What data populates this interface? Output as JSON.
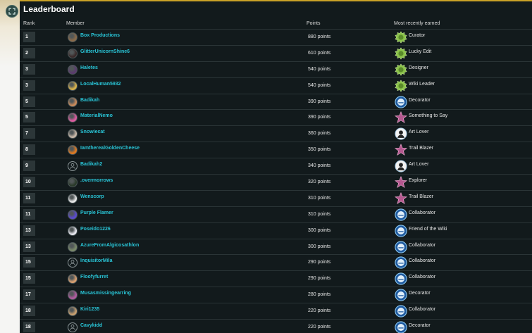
{
  "leaderboard": {
    "title": "Leaderboard",
    "columns": {
      "rank": "Rank",
      "member": "Member",
      "points": "Points",
      "badge": "Most recently earned"
    },
    "rows": [
      {
        "rank": "1",
        "member": "Box Productions",
        "points": "880 points",
        "badge": "Curator",
        "badge_icon": "green-star-badge-icon",
        "avatar": "custom"
      },
      {
        "rank": "2",
        "member": "GlitterUnicornShine6",
        "points": "610 points",
        "badge": "Lucky Edit",
        "badge_icon": "green-star-badge-icon",
        "avatar": "custom"
      },
      {
        "rank": "3",
        "member": "Haletes",
        "points": "540 points",
        "badge": "Designer",
        "badge_icon": "green-star-badge-icon",
        "avatar": "custom"
      },
      {
        "rank": "3",
        "member": "LocalHuman5932",
        "points": "540 points",
        "badge": "Wiki Leader",
        "badge_icon": "green-star-badge-icon",
        "avatar": "custom"
      },
      {
        "rank": "5",
        "member": "Badikah",
        "points": "390 points",
        "badge": "Decorator",
        "badge_icon": "blue-circle-badge-icon",
        "avatar": "custom"
      },
      {
        "rank": "5",
        "member": "MaterialNemo",
        "points": "390 points",
        "badge": "Something to Say",
        "badge_icon": "pink-star-badge-icon",
        "avatar": "custom"
      },
      {
        "rank": "7",
        "member": "Snowiecat",
        "points": "360 points",
        "badge": "Art Lover",
        "badge_icon": "portrait-badge-icon",
        "avatar": "custom"
      },
      {
        "rank": "8",
        "member": "IamtherealGoldenCheese",
        "points": "350 points",
        "badge": "Trail Blazer",
        "badge_icon": "pink-star-badge-icon",
        "avatar": "custom"
      },
      {
        "rank": "9",
        "member": "Badikah2",
        "points": "340 points",
        "badge": "Art Lover",
        "badge_icon": "portrait-badge-icon",
        "avatar": "default"
      },
      {
        "rank": "10",
        "member": ".overmorrows",
        "points": "320 points",
        "badge": "Explorer",
        "badge_icon": "pink-star-badge-icon",
        "avatar": "custom"
      },
      {
        "rank": "11",
        "member": "Wenscorp",
        "points": "310 points",
        "badge": "Trail Blazer",
        "badge_icon": "pink-star-badge-icon",
        "avatar": "custom"
      },
      {
        "rank": "11",
        "member": "Purple Flamer",
        "points": "310 points",
        "badge": "Collaborator",
        "badge_icon": "blue-circle-badge-icon",
        "avatar": "custom"
      },
      {
        "rank": "13",
        "member": "Poseido1226",
        "points": "300 points",
        "badge": "Friend of the Wiki",
        "badge_icon": "blue-circle-badge-icon",
        "avatar": "custom"
      },
      {
        "rank": "13",
        "member": "AzureFromAlgicosathlon",
        "points": "300 points",
        "badge": "Collaborator",
        "badge_icon": "blue-circle-badge-icon",
        "avatar": "custom"
      },
      {
        "rank": "15",
        "member": "InquisitorMila",
        "points": "290 points",
        "badge": "Collaborator",
        "badge_icon": "blue-circle-badge-icon",
        "avatar": "default"
      },
      {
        "rank": "15",
        "member": "Floofyfurret",
        "points": "290 points",
        "badge": "Collaborator",
        "badge_icon": "blue-circle-badge-icon",
        "avatar": "custom"
      },
      {
        "rank": "17",
        "member": "Musasmissingearring",
        "points": "280 points",
        "badge": "Decorator",
        "badge_icon": "blue-circle-badge-icon",
        "avatar": "custom"
      },
      {
        "rank": "18",
        "member": "Kiri1235",
        "points": "220 points",
        "badge": "Collaborator",
        "badge_icon": "blue-circle-badge-icon",
        "avatar": "custom"
      },
      {
        "rank": "18",
        "member": "Cavykidd",
        "points": "220 points",
        "badge": "Decorator",
        "badge_icon": "blue-circle-badge-icon",
        "avatar": "default"
      }
    ]
  },
  "colors": {
    "panel_bg": "#121a1c",
    "link": "#29c4d6",
    "accent_gold": "#c9a227"
  }
}
